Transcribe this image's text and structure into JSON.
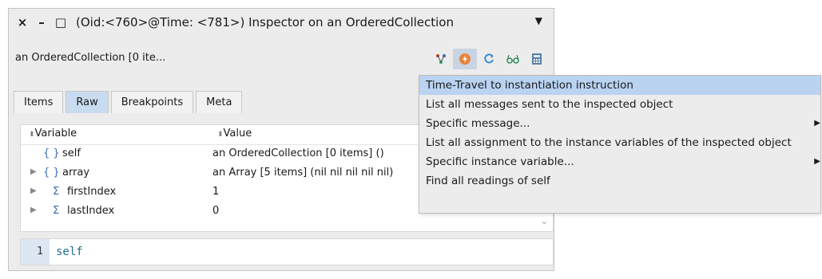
{
  "window": {
    "title": "(Oid:<760>@Time: <781>) Inspector on an OrderedCollection",
    "close_glyph": "×",
    "minimize_glyph": "–",
    "maximize_glyph": "□",
    "menu_glyph": "▼"
  },
  "toolbar": {
    "object_label": "an OrderedCollection [0 ite...",
    "icons": [
      "hierarchy-icon",
      "time-travel-icon",
      "refresh-icon",
      "glasses-icon",
      "calculator-icon"
    ]
  },
  "tabs": [
    {
      "label": "Items",
      "selected": false
    },
    {
      "label": "Raw",
      "selected": true
    },
    {
      "label": "Breakpoints",
      "selected": false
    },
    {
      "label": "Meta",
      "selected": false
    }
  ],
  "table": {
    "headers": {
      "variable": "Variable",
      "value": "Value"
    },
    "rows": [
      {
        "icon": "{ }",
        "name": "self",
        "value": "an OrderedCollection [0 items] ()",
        "expandable": false
      },
      {
        "icon": "{ }",
        "name": "array",
        "value": "an Array [5 items] (nil nil nil nil nil)",
        "expandable": true
      },
      {
        "icon": "Σ",
        "name": "firstIndex",
        "value": "1",
        "expandable": true
      },
      {
        "icon": "Σ",
        "name": "lastIndex",
        "value": "0",
        "expandable": true
      }
    ]
  },
  "editor": {
    "line_number": "1",
    "code": "self"
  },
  "context_menu": {
    "items": [
      {
        "label": "Time-Travel to instantiation instruction",
        "highlighted": true,
        "submenu": false
      },
      {
        "label": "List all messages sent to the inspected object",
        "highlighted": false,
        "submenu": false
      },
      {
        "label": "Specific message...",
        "highlighted": false,
        "submenu": true
      },
      {
        "label": "List all assignment to the instance variables of the inspected object",
        "highlighted": false,
        "submenu": false
      },
      {
        "label": "Specific instance variable...",
        "highlighted": false,
        "submenu": true
      },
      {
        "label": "Find all readings of self",
        "highlighted": false,
        "submenu": false
      }
    ]
  },
  "colors": {
    "selection": "#b9d3f1",
    "selected_tab": "#c8dbf0",
    "active_tool": "#c9d4e3",
    "code_text": "#1f6e8c"
  }
}
